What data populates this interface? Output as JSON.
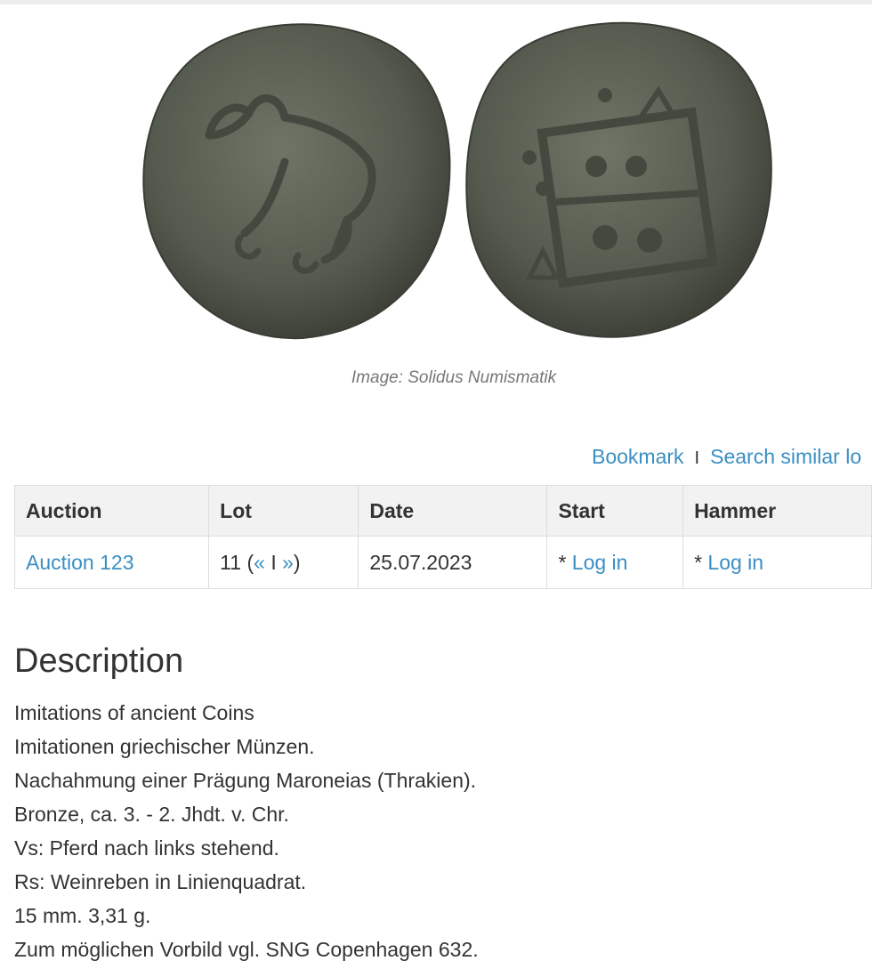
{
  "image": {
    "alt_obverse": "coin-obverse-horse",
    "alt_reverse": "coin-reverse-vine-square",
    "caption": "Image: Solidus Numismatik"
  },
  "actions": {
    "bookmark": "Bookmark",
    "separator": "I",
    "search_similar": "Search similar lo"
  },
  "table": {
    "headers": [
      "Auction",
      "Lot",
      "Date",
      "Start",
      "Hammer"
    ],
    "row": {
      "auction": "Auction 123",
      "lot_number": "11",
      "lot_open": "(",
      "prev": "«",
      "nav_sep": "I",
      "next": "»",
      "lot_close": ")",
      "date": "25.07.2023",
      "start_prefix": "* ",
      "start_link": "Log in",
      "hammer_prefix": "* ",
      "hammer_link": "Log in"
    }
  },
  "description": {
    "heading": "Description",
    "lines": [
      "Imitations of ancient Coins",
      "Imitationen griechischer Münzen.",
      "Nachahmung einer Prägung Maroneias (Thrakien).",
      "Bronze, ca. 3. - 2. Jhdt. v. Chr.",
      "Vs: Pferd nach links stehend.",
      "Rs: Weinreben in Linienquadrat.",
      "15 mm. 3,31 g.",
      "Zum möglichen Vorbild vgl. SNG Copenhagen 632."
    ]
  },
  "colors": {
    "link": "#3a8fc2",
    "text": "#333333",
    "header_bg": "#f2f2f2",
    "border": "#dddddd",
    "coin": "#5a5e52"
  }
}
